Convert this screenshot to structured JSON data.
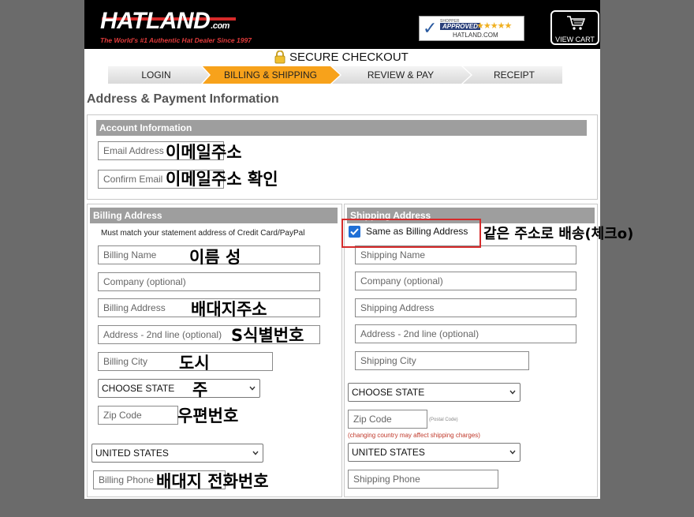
{
  "header": {
    "logo_hat": "HAT",
    "logo_land": "LAND",
    "logo_com": ".com",
    "tagline": "The World's #1 Authentic Hat Dealer Since 1997",
    "approved_shopper": "SHOPPER",
    "approved_label": "APPROVED",
    "approved_stars": "★★★★★",
    "approved_site": "HATLAND.COM",
    "cart_label": "VIEW CART"
  },
  "secure_checkout": "SECURE CHECKOUT",
  "steps": [
    {
      "label": "LOGIN",
      "active": false
    },
    {
      "label": "BILLING & SHIPPING",
      "active": true
    },
    {
      "label": "REVIEW & PAY",
      "active": false
    },
    {
      "label": "RECEIPT",
      "active": false
    }
  ],
  "section_title": "Address & Payment Information",
  "account": {
    "title": "Account Information",
    "email_placeholder": "Email Address",
    "confirm_email_placeholder": "Confirm Email"
  },
  "billing": {
    "title": "Billing Address",
    "note": "Must match your statement address of Credit Card/PayPal",
    "name": "Billing Name",
    "company": "Company (optional)",
    "address": "Billing Address",
    "address2": "Address - 2nd line (optional)",
    "city": "Billing City",
    "state": "CHOOSE STATE",
    "zip": "Zip Code",
    "country": "UNITED STATES",
    "phone": "Billing Phone"
  },
  "shipping": {
    "title": "Shipping Address",
    "same_as_billing": "Same as Billing Address",
    "same_checked": true,
    "name": "Shipping Name",
    "company": "Company (optional)",
    "address": "Shipping Address",
    "address2": "Address - 2nd line (optional)",
    "city": "Shipping City",
    "state": "CHOOSE STATE",
    "zip": "Zip Code",
    "postal_note": "(Postal Code)",
    "country_note": "(changing country may affect shipping charges)",
    "country": "UNITED STATES",
    "phone": "Shipping Phone"
  },
  "annotations": {
    "email": "이메일주소",
    "confirm_email": "이메일주소 확인",
    "same_address": "같은 주소로 배송(체크o)",
    "name": "이름 성",
    "address": "배대지주소",
    "address2": "S식별번호",
    "city": "도시",
    "state": "주",
    "zip": "우편번호",
    "phone": "배대지 전화번호"
  },
  "colors": {
    "active_step": "#f7a21b",
    "section_bar": "#9e9e9e",
    "highlight_box": "#d52b2b",
    "checkbox": "#1f6fd6"
  }
}
